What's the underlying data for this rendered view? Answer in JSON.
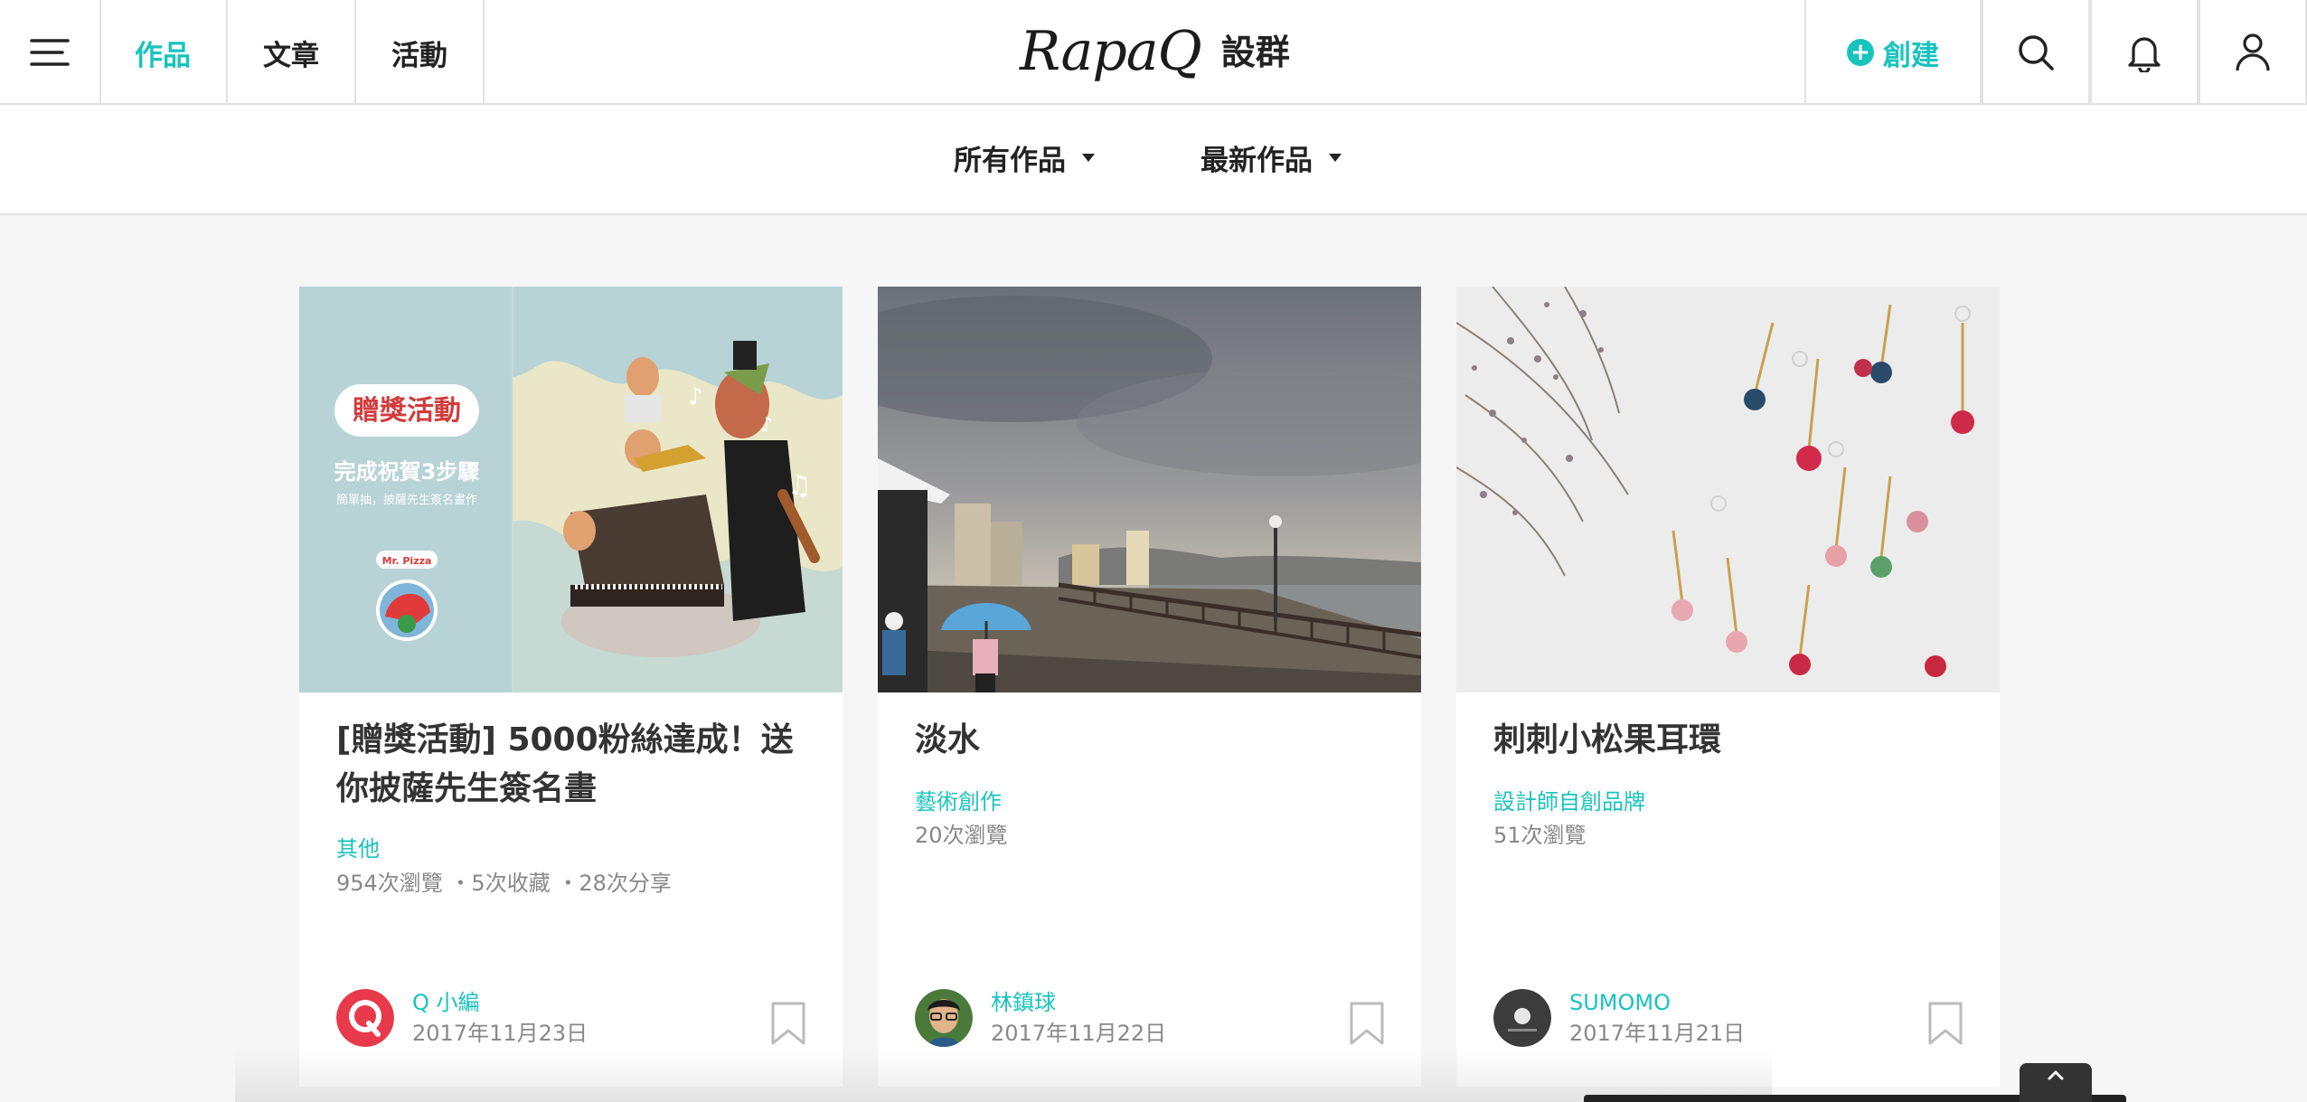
{
  "nav": {
    "tabs": [
      {
        "label": "作品",
        "active": true
      },
      {
        "label": "文章",
        "active": false
      },
      {
        "label": "活動",
        "active": false
      }
    ],
    "brand_word": "RapaQ",
    "brand_sub": "設群",
    "create_label": "創建",
    "accent_color": "#18c3bd"
  },
  "filters": [
    {
      "label": "所有作品"
    },
    {
      "label": "最新作品"
    }
  ],
  "cards": [
    {
      "title": "[贈獎活動] 5000粉絲達成！送你披薩先生簽名畫",
      "category": "其他",
      "stats": "954次瀏覽 ・5次收藏 ・28次分享",
      "author": "Q 小編",
      "date": "2017年11月23日",
      "image": {
        "badge": "贈獎活動",
        "headline": "完成祝賀3步驟",
        "subline": "簡單抽，披薩先生簽名畫作",
        "tag": "Mr. Pizza"
      }
    },
    {
      "title": "淡水",
      "category": "藝術創作",
      "stats": "20次瀏覽",
      "author": "林鎮球",
      "date": "2017年11月22日"
    },
    {
      "title": "刺刺小松果耳環",
      "category": "設計師自創品牌",
      "stats": "51次瀏覽",
      "author": "SUMOMO",
      "date": "2017年11月21日"
    }
  ],
  "icons": [
    "hamburger-menu-icon",
    "plus-circle-icon",
    "search-icon",
    "bell-icon",
    "user-icon",
    "bookmark-icon",
    "chevron-up-icon"
  ]
}
